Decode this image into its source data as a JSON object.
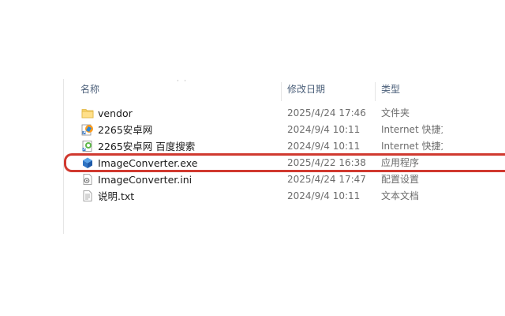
{
  "columns": {
    "name": "名称",
    "date": "修改日期",
    "type": "类型",
    "sort_indicator": "˄"
  },
  "files": [
    {
      "name": "vendor",
      "date": "2025/4/24 17:46",
      "type": "文件夹",
      "icon": "folder-icon"
    },
    {
      "name": "2265安卓网",
      "date": "2024/9/4 10:11",
      "type": "Internet 快捷方式",
      "icon": "internet-shortcut-icon"
    },
    {
      "name": "2265安卓网 百度搜索",
      "date": "2024/9/4 10:11",
      "type": "Internet 快捷方式",
      "icon": "internet-shortcut-icon"
    },
    {
      "name": "ImageConverter.exe",
      "date": "2025/4/22 16:38",
      "type": "应用程序",
      "icon": "exe-icon"
    },
    {
      "name": "ImageConverter.ini",
      "date": "2025/4/24 17:47",
      "type": "配置设置",
      "icon": "ini-file-icon"
    },
    {
      "name": "说明.txt",
      "date": "2024/9/4 10:11",
      "type": "文本文档",
      "icon": "text-file-icon"
    }
  ],
  "highlight": {
    "target": "ImageConverter.exe",
    "color": "#d0392f"
  }
}
